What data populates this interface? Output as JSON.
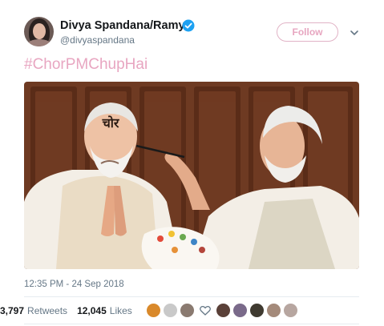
{
  "user": {
    "display_name": "Divya Spandana/Ramya",
    "handle": "@divyaspandana",
    "verified": true,
    "avatar_icon": "profile-photo"
  },
  "follow_button": {
    "label": "Follow",
    "color": "#e7a6c0"
  },
  "more_menu_icon": "chevron-down-icon",
  "tweet": {
    "hashtag": "#ChorPMChupHai",
    "hashtag_color": "#e8a6c1",
    "image": {
      "forehead_text": "चोर",
      "description_icons": [
        "wax-statue",
        "painter",
        "paint-brush",
        "paint-palette"
      ]
    },
    "timestamp": "12:35 PM - 24 Sep 2018"
  },
  "stats": {
    "retweets_count": "3,797",
    "retweets_label": "Retweets",
    "likes_count": "12,045",
    "likes_label": "Likes"
  },
  "likers": {
    "icons": [
      "liker-avatar",
      "liker-avatar",
      "liker-avatar",
      "heart-icon",
      "liker-avatar",
      "liker-avatar",
      "liker-avatar",
      "liker-avatar",
      "liker-avatar"
    ],
    "colors": [
      "#d9892b",
      "#c9c9c9",
      "#8a7a70",
      "#5a4038",
      "#7a6a8a",
      "#3f3a30",
      "#a48a7a",
      "#b7a6a0"
    ]
  }
}
